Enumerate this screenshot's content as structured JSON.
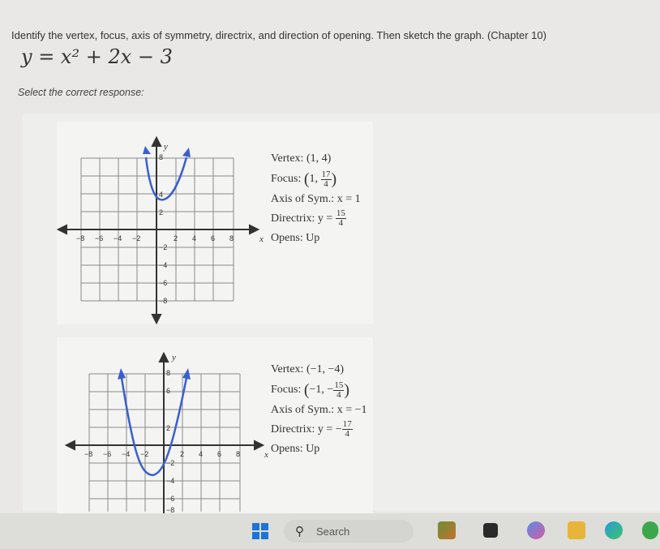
{
  "question": {
    "text": "Identify the vertex, focus, axis of symmetry, directrix, and direction of opening. Then sketch the graph. (Chapter 10)",
    "equation": "y = x² + 2x − 3",
    "prompt": "Select the correct response:"
  },
  "options": [
    {
      "vertex_label": "Vertex:",
      "vertex": "(1, 4)",
      "focus_label": "Focus:",
      "focus_x": "1,",
      "focus_num": "17",
      "focus_den": "4",
      "axis_label": "Axis of Sym.:",
      "axis": "x = 1",
      "directrix_label": "Directrix:",
      "directrix_pre": "y =",
      "directrix_num": "15",
      "directrix_den": "4",
      "opens_label": "Opens:",
      "opens": "Up",
      "graph": {
        "x_ticks": [
          "−8",
          "−6",
          "−4",
          "−2",
          "2",
          "4",
          "6",
          "8"
        ],
        "y_ticks": [
          "8",
          "4",
          "2",
          "−2",
          "−4",
          "−6",
          "−8"
        ],
        "x_axis_label": "x",
        "y_axis_label": "y"
      }
    },
    {
      "vertex_label": "Vertex:",
      "vertex": "(−1, −4)",
      "focus_label": "Focus:",
      "focus_x": "−1, −",
      "focus_num": "15",
      "focus_den": "4",
      "axis_label": "Axis of Sym.:",
      "axis": "x = −1",
      "directrix_label": "Directrix:",
      "directrix_pre": "y = −",
      "directrix_num": "17",
      "directrix_den": "4",
      "opens_label": "Opens:",
      "opens": "Up",
      "graph": {
        "x_ticks": [
          "−8",
          "−6",
          "−4",
          "−2",
          "2",
          "4",
          "6",
          "8"
        ],
        "y_ticks": [
          "8",
          "6",
          "2",
          "−2",
          "−4",
          "−6",
          "−8"
        ],
        "x_axis_label": "x",
        "y_axis_label": "y"
      }
    }
  ],
  "taskbar": {
    "search_label": "Search",
    "accent": "#1e73d8"
  }
}
